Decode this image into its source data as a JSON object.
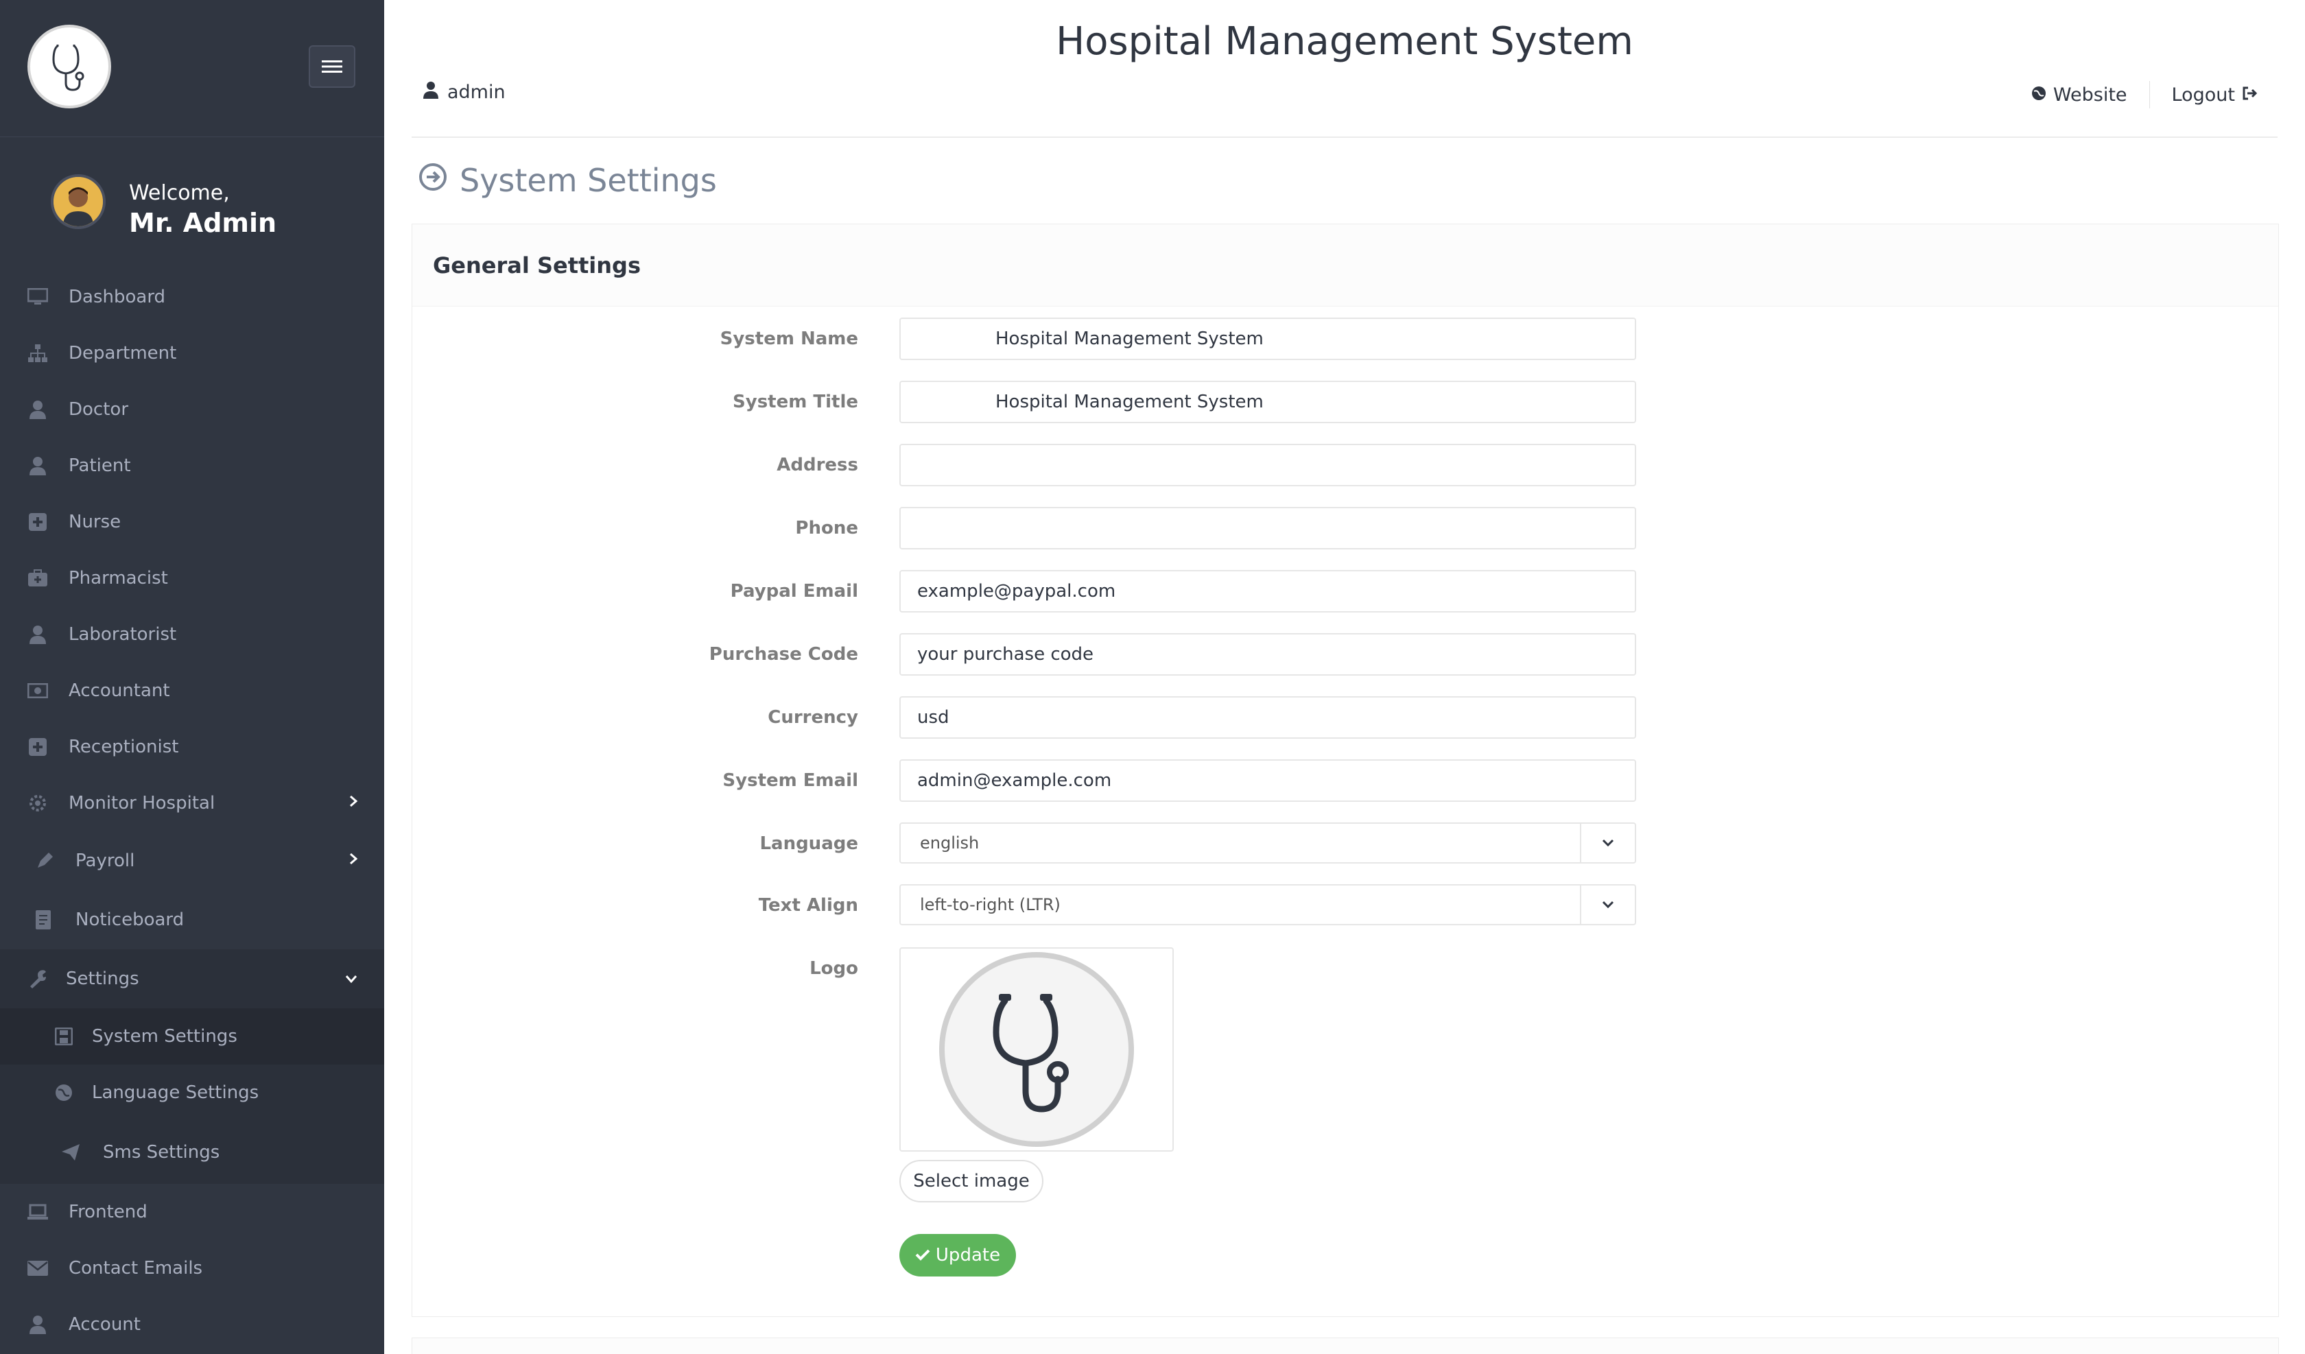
{
  "sidebar": {
    "welcome_line1": "Welcome,",
    "welcome_line2": "Mr. Admin",
    "items": [
      {
        "label": "Dashboard",
        "icon": "monitor-icon"
      },
      {
        "label": "Department",
        "icon": "sitemap-icon"
      },
      {
        "label": "Doctor",
        "icon": "user-md-icon"
      },
      {
        "label": "Patient",
        "icon": "user-icon"
      },
      {
        "label": "Nurse",
        "icon": "plus-square-icon"
      },
      {
        "label": "Pharmacist",
        "icon": "medkit-icon"
      },
      {
        "label": "Laboratorist",
        "icon": "user-icon"
      },
      {
        "label": "Accountant",
        "icon": "money-icon"
      },
      {
        "label": "Receptionist",
        "icon": "plus-square-icon"
      },
      {
        "label": "Monitor Hospital",
        "icon": "gear-icon"
      },
      {
        "label": "Payroll",
        "icon": "edit-icon"
      },
      {
        "label": "Noticeboard",
        "icon": "document-icon"
      },
      {
        "label": "Settings",
        "icon": "wrench-icon"
      },
      {
        "label": "System Settings",
        "icon": "save-icon"
      },
      {
        "label": "Language Settings",
        "icon": "globe-icon"
      },
      {
        "label": "Sms Settings",
        "icon": "send-icon"
      },
      {
        "label": "Frontend",
        "icon": "laptop-icon"
      },
      {
        "label": "Contact Emails",
        "icon": "envelope-icon"
      },
      {
        "label": "Account",
        "icon": "user-icon"
      }
    ]
  },
  "header": {
    "title": "Hospital Management System",
    "user": "admin",
    "website": "Website",
    "logout": "Logout"
  },
  "page": {
    "title": "System Settings",
    "panel_title": "General Settings"
  },
  "form": {
    "fields": [
      {
        "label": "System Name",
        "value": "Hospital Management System"
      },
      {
        "label": "System Title",
        "value": "Hospital Management System"
      },
      {
        "label": "Address",
        "value": ""
      },
      {
        "label": "Phone",
        "value": ""
      },
      {
        "label": "Paypal Email",
        "value": "example@paypal.com"
      },
      {
        "label": "Purchase Code",
        "value": "your purchase code"
      },
      {
        "label": "Currency",
        "value": "usd"
      },
      {
        "label": "System Email",
        "value": "admin@example.com"
      }
    ],
    "language_label": "Language",
    "language_value": "english",
    "text_align_label": "Text Align",
    "text_align_value": "left-to-right (LTR)",
    "logo_label": "Logo",
    "select_image": "Select image",
    "update": "Update"
  },
  "colors": {
    "sidebar_bg": "#303641",
    "accent_green": "#5db55b",
    "text_dark": "#303641"
  }
}
